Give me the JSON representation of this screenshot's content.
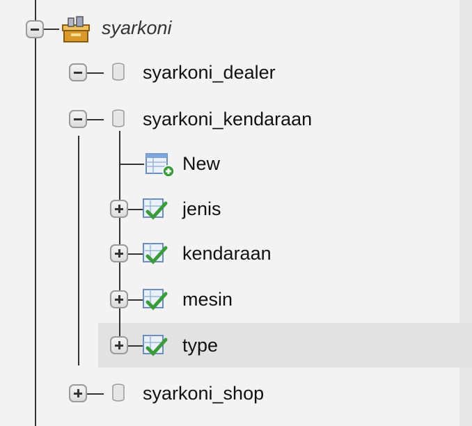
{
  "tree": {
    "root": {
      "label": "syarkoni",
      "icon": "database-server-icon",
      "expanded": true
    },
    "databases": [
      {
        "label": "syarkoni_dealer",
        "icon": "database-icon",
        "expanded": true
      },
      {
        "label": "syarkoni_kendaraan",
        "icon": "database-icon",
        "expanded": true
      },
      {
        "label": "syarkoni_shop",
        "icon": "database-icon",
        "expanded": false
      }
    ],
    "tables": [
      {
        "label": "New",
        "icon": "new-table-icon"
      },
      {
        "label": "jenis",
        "icon": "table-icon",
        "expanded": false
      },
      {
        "label": "kendaraan",
        "icon": "table-icon",
        "expanded": false
      },
      {
        "label": "mesin",
        "icon": "table-icon",
        "expanded": false
      },
      {
        "label": "type",
        "icon": "table-icon",
        "expanded": false,
        "hovered": true
      }
    ]
  },
  "colors": {
    "background": "#f3f3f3",
    "hover": "#e2e2e2",
    "line": "#333333"
  }
}
